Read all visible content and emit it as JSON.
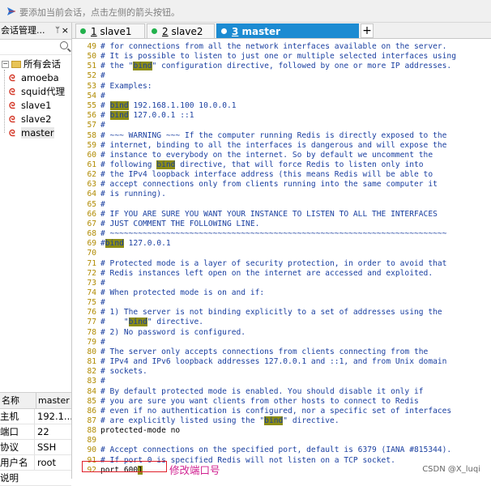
{
  "hint_bar": {
    "text": "要添加当前会话，点击左侧的箭头按钮。"
  },
  "session_panel": {
    "title": "会话管理...",
    "pin": "ᛘ",
    "close": "×",
    "root": {
      "expander": "−",
      "label": "所有会话"
    },
    "sessions": [
      {
        "label": "amoeba"
      },
      {
        "label": "squid代理"
      },
      {
        "label": "slave1"
      },
      {
        "label": "slave2"
      },
      {
        "label": "master"
      }
    ]
  },
  "properties": {
    "headers": [
      "名称",
      "master"
    ],
    "rows": [
      {
        "k": "主机",
        "v": "192.1..."
      },
      {
        "k": "端口",
        "v": "22"
      },
      {
        "k": "协议",
        "v": "SSH"
      },
      {
        "k": "用户名",
        "v": "root"
      },
      {
        "k": "说明",
        "v": ""
      }
    ]
  },
  "tabs": [
    {
      "num": "1",
      "label": "slave1"
    },
    {
      "num": "2",
      "label": "slave2"
    },
    {
      "num": "3",
      "label": "master"
    }
  ],
  "tab_add": "+",
  "editor_lines": [
    {
      "n": "49",
      "parts": [
        {
          "t": "# for connections from all the network interfaces available on the server.",
          "c": "cmt"
        }
      ]
    },
    {
      "n": "50",
      "parts": [
        {
          "t": "# It is possible to listen to just one or multiple selected interfaces using",
          "c": "cmt"
        }
      ]
    },
    {
      "n": "51",
      "parts": [
        {
          "t": "# the \"",
          "c": "cmt"
        },
        {
          "t": "bind",
          "c": "hl"
        },
        {
          "t": "\" configuration directive, followed by one or more IP addresses.",
          "c": "cmt"
        }
      ]
    },
    {
      "n": "52",
      "parts": [
        {
          "t": "#",
          "c": "cmt"
        }
      ]
    },
    {
      "n": "53",
      "parts": [
        {
          "t": "# Examples:",
          "c": "cmt"
        }
      ]
    },
    {
      "n": "54",
      "parts": [
        {
          "t": "#",
          "c": "cmt"
        }
      ]
    },
    {
      "n": "55",
      "parts": [
        {
          "t": "# ",
          "c": "cmt"
        },
        {
          "t": "bind",
          "c": "hl"
        },
        {
          "t": " 192.168.1.100 10.0.0.1",
          "c": "cmt"
        }
      ]
    },
    {
      "n": "56",
      "parts": [
        {
          "t": "# ",
          "c": "cmt"
        },
        {
          "t": "bind",
          "c": "hl"
        },
        {
          "t": " 127.0.0.1 ::1",
          "c": "cmt"
        }
      ]
    },
    {
      "n": "57",
      "parts": [
        {
          "t": "#",
          "c": "cmt"
        }
      ]
    },
    {
      "n": "58",
      "parts": [
        {
          "t": "# ~~~ WARNING ~~~ If the computer running Redis is directly exposed to the",
          "c": "cmt"
        }
      ]
    },
    {
      "n": "59",
      "parts": [
        {
          "t": "# internet, binding to all the interfaces is dangerous and will expose the",
          "c": "cmt"
        }
      ]
    },
    {
      "n": "60",
      "parts": [
        {
          "t": "# instance to everybody on the internet. So by default we uncomment the",
          "c": "cmt"
        }
      ]
    },
    {
      "n": "61",
      "parts": [
        {
          "t": "# following ",
          "c": "cmt"
        },
        {
          "t": "bind",
          "c": "hl"
        },
        {
          "t": " directive, that will force Redis to listen only into",
          "c": "cmt"
        }
      ]
    },
    {
      "n": "62",
      "parts": [
        {
          "t": "# the IPv4 loopback interface address (this means Redis will be able to",
          "c": "cmt"
        }
      ]
    },
    {
      "n": "63",
      "parts": [
        {
          "t": "# accept connections only from clients running into the same computer it",
          "c": "cmt"
        }
      ]
    },
    {
      "n": "64",
      "parts": [
        {
          "t": "# is running).",
          "c": "cmt"
        }
      ]
    },
    {
      "n": "65",
      "parts": [
        {
          "t": "#",
          "c": "cmt"
        }
      ]
    },
    {
      "n": "66",
      "parts": [
        {
          "t": "# IF YOU ARE SURE YOU WANT YOUR INSTANCE TO LISTEN TO ALL THE INTERFACES",
          "c": "cmt"
        }
      ]
    },
    {
      "n": "67",
      "parts": [
        {
          "t": "# JUST COMMENT THE FOLLOWING LINE.",
          "c": "cmt"
        }
      ]
    },
    {
      "n": "68",
      "parts": [
        {
          "t": "# ~~~~~~~~~~~~~~~~~~~~~~~~~~~~~~~~~~~~~~~~~~~~~~~~~~~~~~~~~~~~~~~~~~~~~~~~",
          "c": "cmt"
        }
      ]
    },
    {
      "n": "69",
      "parts": [
        {
          "t": "#",
          "c": "cmt"
        },
        {
          "t": "bind",
          "c": "hl"
        },
        {
          "t": " 127.0.0.1",
          "c": "cmt"
        }
      ]
    },
    {
      "n": "70",
      "parts": [
        {
          "t": "",
          "c": "cmt"
        }
      ]
    },
    {
      "n": "71",
      "parts": [
        {
          "t": "# Protected mode is a layer of security protection, in order to avoid that",
          "c": "cmt"
        }
      ]
    },
    {
      "n": "72",
      "parts": [
        {
          "t": "# Redis instances left open on the internet are accessed and exploited.",
          "c": "cmt"
        }
      ]
    },
    {
      "n": "73",
      "parts": [
        {
          "t": "#",
          "c": "cmt"
        }
      ]
    },
    {
      "n": "74",
      "parts": [
        {
          "t": "# When protected mode is on and if:",
          "c": "cmt"
        }
      ]
    },
    {
      "n": "75",
      "parts": [
        {
          "t": "#",
          "c": "cmt"
        }
      ]
    },
    {
      "n": "76",
      "parts": [
        {
          "t": "# 1) The server is not binding explicitly to a set of addresses using the",
          "c": "cmt"
        }
      ]
    },
    {
      "n": "77",
      "parts": [
        {
          "t": "#    \"",
          "c": "cmt"
        },
        {
          "t": "bind",
          "c": "hl"
        },
        {
          "t": "\" directive.",
          "c": "cmt"
        }
      ]
    },
    {
      "n": "78",
      "parts": [
        {
          "t": "# 2) No password is configured.",
          "c": "cmt"
        }
      ]
    },
    {
      "n": "79",
      "parts": [
        {
          "t": "#",
          "c": "cmt"
        }
      ]
    },
    {
      "n": "80",
      "parts": [
        {
          "t": "# The server only accepts connections from clients connecting from the",
          "c": "cmt"
        }
      ]
    },
    {
      "n": "81",
      "parts": [
        {
          "t": "# IPv4 and IPv6 loopback addresses 127.0.0.1 and ::1, and from Unix domain",
          "c": "cmt"
        }
      ]
    },
    {
      "n": "82",
      "parts": [
        {
          "t": "# sockets.",
          "c": "cmt"
        }
      ]
    },
    {
      "n": "83",
      "parts": [
        {
          "t": "#",
          "c": "cmt"
        }
      ]
    },
    {
      "n": "84",
      "parts": [
        {
          "t": "# By default protected mode is enabled. You should disable it only if",
          "c": "cmt"
        }
      ]
    },
    {
      "n": "85",
      "parts": [
        {
          "t": "# you are sure you want clients from other hosts to connect to Redis",
          "c": "cmt"
        }
      ]
    },
    {
      "n": "86",
      "parts": [
        {
          "t": "# even if no authentication is configured, nor a specific set of interfaces",
          "c": "cmt"
        }
      ]
    },
    {
      "n": "87",
      "parts": [
        {
          "t": "# are explicitly listed using the \"",
          "c": "cmt"
        },
        {
          "t": "bind",
          "c": "hl"
        },
        {
          "t": "\" directive.",
          "c": "cmt"
        }
      ]
    },
    {
      "n": "88",
      "parts": [
        {
          "t": "protected-mode no",
          "c": "plain"
        }
      ]
    },
    {
      "n": "89",
      "parts": [
        {
          "t": "",
          "c": "cmt"
        }
      ]
    },
    {
      "n": "90",
      "parts": [
        {
          "t": "# Accept connections on the specified port, default is 6379 (IANA #815344).",
          "c": "cmt"
        }
      ]
    },
    {
      "n": "91",
      "parts": [
        {
          "t": "# If port 0 is specified Redis will not listen on a TCP socket.",
          "c": "cmt"
        }
      ]
    },
    {
      "n": "92",
      "parts": [
        {
          "t": "port 600",
          "c": "plain"
        },
        {
          "t": "1",
          "c": "hl2"
        }
      ]
    }
  ],
  "annotation": "修改端口号",
  "watermark": "CSDN @X_luqi",
  "colors": {
    "comment": "#1a3fa0",
    "line_number": "#b08a00",
    "highlight": "#8c8c14",
    "active_tab": "#1c8bd2",
    "annotation": "#d02090",
    "red_box": "#e0202a"
  }
}
